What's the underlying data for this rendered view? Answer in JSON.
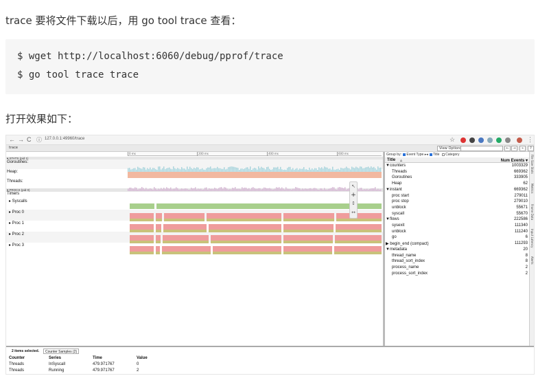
{
  "article": {
    "intro": "trace 要将文件下载以后，用 go tool trace 查看：",
    "code_lines": [
      "$ wget http://localhost:6060/debug/pprof/trace",
      "$ go tool trace trace"
    ],
    "outro": "打开效果如下："
  },
  "browser": {
    "back": "←",
    "forward": "→",
    "reload": "C",
    "info": "ⓘ",
    "url": "127.0.0.1:49960/trace",
    "tab_title": "trace",
    "star": "☆",
    "menu": "⋮"
  },
  "viewer": {
    "view_options": "View Options",
    "nav_buttons": [
      "←",
      "→",
      "»",
      "?"
    ],
    "ruler_ticks": [
      "0 ms",
      "200 ms",
      "400 ms",
      "600 ms"
    ],
    "rows": [
      {
        "label": "▾ STATS (pid 1)",
        "kind": "hdr"
      },
      {
        "label": "Goroutines:",
        "kind": "row"
      },
      {
        "label": "Heap:",
        "kind": "row"
      },
      {
        "label": "Threads:",
        "kind": "row"
      },
      {
        "label": "▾ PROCS (pid 0)",
        "kind": "hdr"
      },
      {
        "label": "Timers",
        "kind": "row"
      },
      {
        "label": "▸ Syscalls",
        "kind": "proc"
      },
      {
        "label": "▸ Proc 0",
        "kind": "proc"
      },
      {
        "label": "▸ Proc 1",
        "kind": "proc"
      },
      {
        "label": "▸ Proc 2",
        "kind": "proc"
      },
      {
        "label": "▸ Proc 3",
        "kind": "proc"
      }
    ],
    "zoom_controls": [
      "↖",
      "+",
      "↕",
      "↔"
    ],
    "colors": {
      "goroutines": "#a9d4dc",
      "heap": "#f2b8a0",
      "threads": "#d7b9d5",
      "syscalls": "#a8cf8c",
      "proc_red": "#ef9c9c",
      "proc_olive": "#c9c27a"
    }
  },
  "sidepanel": {
    "group_by": "Group by:",
    "event_type": "Event Type",
    "title_opt": "Title",
    "category_opt": "Category",
    "col_title": "Title",
    "sort_mark": "▵",
    "col_events": "Num Events ▾",
    "rows": [
      {
        "name": "▼counters",
        "count": "1003329",
        "indent": 0
      },
      {
        "name": "Threads",
        "count": "669362",
        "indent": 1
      },
      {
        "name": "Goroutines",
        "count": "333905",
        "indent": 1
      },
      {
        "name": "Heap",
        "count": "62",
        "indent": 1
      },
      {
        "name": "▼instant",
        "count": "669362",
        "indent": 0
      },
      {
        "name": "proc start",
        "count": "279011",
        "indent": 1
      },
      {
        "name": "proc stop",
        "count": "279010",
        "indent": 1
      },
      {
        "name": "unblock",
        "count": "55671",
        "indent": 1
      },
      {
        "name": "syscall",
        "count": "55670",
        "indent": 1
      },
      {
        "name": "▼flows",
        "count": "222586",
        "indent": 0
      },
      {
        "name": "sysexit",
        "count": "111340",
        "indent": 1
      },
      {
        "name": "unblock",
        "count": "111240",
        "indent": 1
      },
      {
        "name": "go",
        "count": "6",
        "indent": 1
      },
      {
        "name": "▶ begin_end (compact)",
        "count": "111293",
        "indent": 0
      },
      {
        "name": "▼metadata",
        "count": "20",
        "indent": 0
      },
      {
        "name": "thread_name",
        "count": "8",
        "indent": 1
      },
      {
        "name": "thread_sort_index",
        "count": "8",
        "indent": 1
      },
      {
        "name": "process_name",
        "count": "2",
        "indent": 1
      },
      {
        "name": "process_sort_index",
        "count": "2",
        "indent": 1
      }
    ],
    "vertical_tabs": [
      "File Size Stats",
      "Metrics",
      "Frame Data",
      "Input Latency",
      "Alerts"
    ]
  },
  "bottom": {
    "selected": "2 items selected.",
    "tab": "Counter Samples (2)",
    "headers": [
      "Counter",
      "Series",
      "Time",
      "Value"
    ],
    "rows": [
      [
        "Threads",
        "InSyscall",
        "479.971767",
        "0"
      ],
      [
        "Threads",
        "Running",
        "479.971767",
        "2"
      ]
    ]
  }
}
